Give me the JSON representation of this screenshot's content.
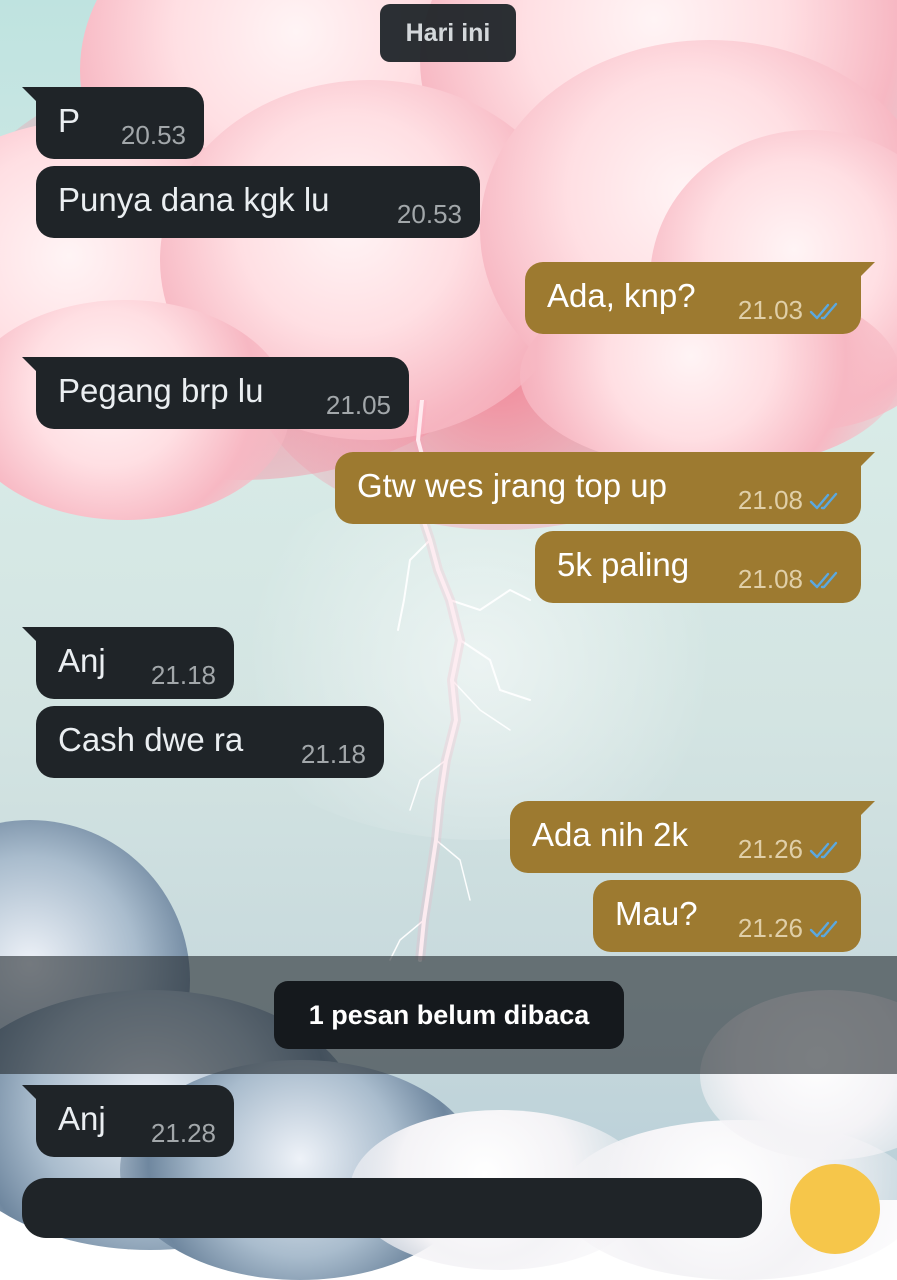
{
  "chat": {
    "date_label": "Hari ini",
    "messages": [
      {
        "text": "P",
        "time": "20.53"
      },
      {
        "text": "Punya dana kgk lu",
        "time": "20.53"
      },
      {
        "text": "Ada, knp?",
        "time": "21.03"
      },
      {
        "text": "Pegang brp lu",
        "time": "21.05"
      },
      {
        "text": "Gtw wes jrang top up",
        "time": "21.08"
      },
      {
        "text": "5k paling",
        "time": "21.08"
      },
      {
        "text": "Anj",
        "time": "21.18"
      },
      {
        "text": "Cash dwe ra",
        "time": "21.18"
      },
      {
        "text": "Ada nih 2k",
        "time": "21.26"
      },
      {
        "text": "Mau?",
        "time": "21.26"
      },
      {
        "text": "Anj",
        "time": "21.28"
      }
    ],
    "unread_label": "1 pesan belum dibaca"
  },
  "colors": {
    "incoming_bubble": "#1f2428",
    "outgoing_bubble": "#9d7a30",
    "read_ticks": "#5aa8e0",
    "scroll_button": "#f6c64a"
  },
  "icons": {
    "read_receipt": "double-check-icon"
  }
}
